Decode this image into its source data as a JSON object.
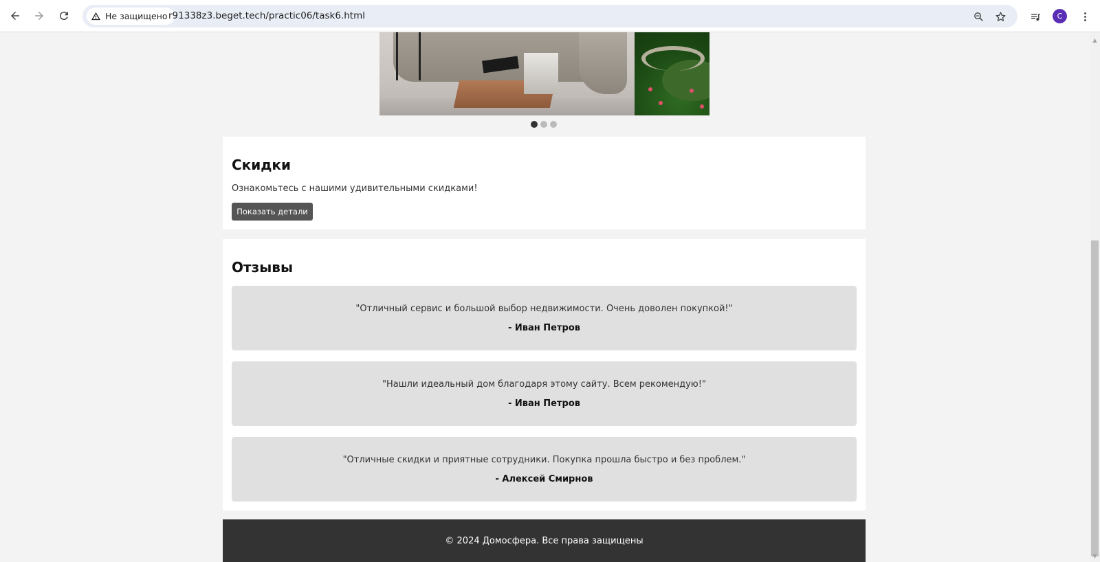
{
  "browser": {
    "security_label": "Не защищено",
    "url": "r91338z3.beget.tech/practic06/task6.html",
    "profile_initial": "C"
  },
  "slider": {
    "slide_count": 3,
    "active_index": 0
  },
  "discounts": {
    "title": "Скидки",
    "text": "Ознакомьтесь с нашими удивительными скидками!",
    "button_label": "Показать детали"
  },
  "reviews": {
    "title": "Отзывы",
    "items": [
      {
        "text": "\"Отличный сервис и большой выбор недвижимости. Очень доволен покупкой!\"",
        "author": "- Иван Петров"
      },
      {
        "text": "\"Нашли идеальный дом благодаря этому сайту. Всем рекомендую!\"",
        "author": "- Иван Петров"
      },
      {
        "text": "\"Отличные скидки и приятные сотрудники. Покупка прошла быстро и без проблем.\"",
        "author": "- Алексей Смирнов"
      }
    ]
  },
  "footer": {
    "text": "© 2024 Домосфера. Все права защищены"
  }
}
